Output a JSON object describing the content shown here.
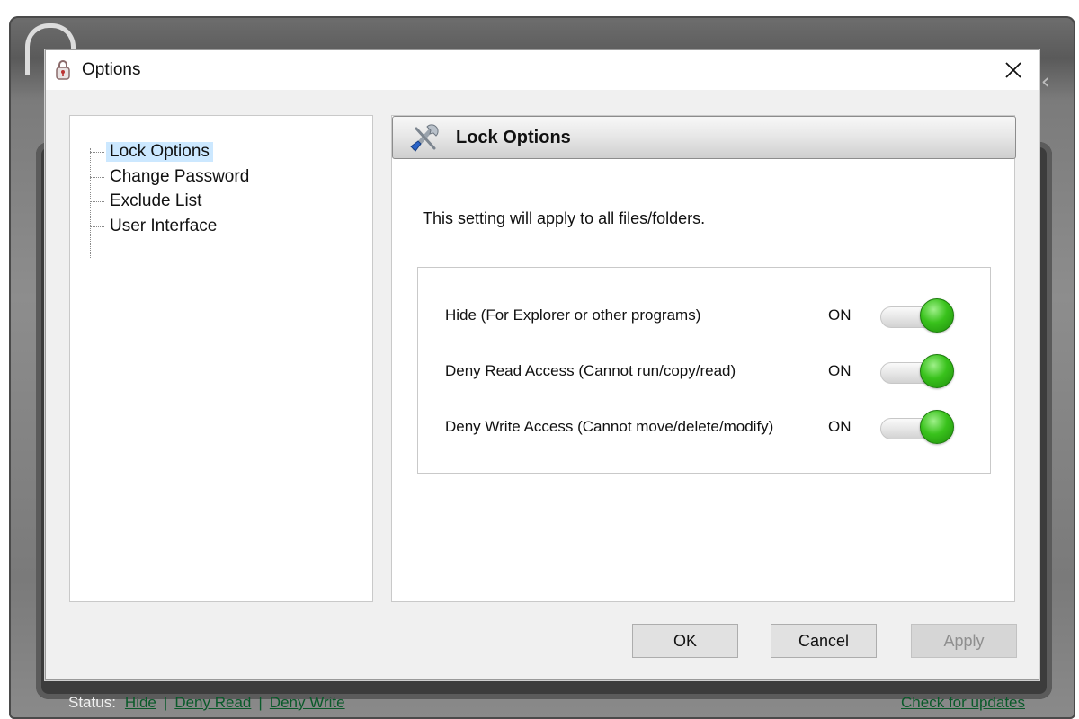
{
  "dialog": {
    "title": "Options",
    "close_label": "✕"
  },
  "tree": {
    "items": [
      {
        "label": "Lock Options",
        "selected": true
      },
      {
        "label": "Change Password",
        "selected": false
      },
      {
        "label": "Exclude List",
        "selected": false
      },
      {
        "label": "User Interface",
        "selected": false
      }
    ]
  },
  "panel": {
    "header_title": "Lock Options",
    "header_icon": "tools-icon",
    "intro": "This setting will apply to all files/folders.",
    "options": [
      {
        "label": "Hide (For Explorer or other programs)",
        "state": "ON",
        "on": true
      },
      {
        "label": "Deny Read Access (Cannot run/copy/read)",
        "state": "ON",
        "on": true
      },
      {
        "label": "Deny Write Access (Cannot move/delete/modify)",
        "state": "ON",
        "on": true
      }
    ]
  },
  "buttons": {
    "ok": "OK",
    "cancel": "Cancel",
    "apply": "Apply"
  },
  "status_bar": {
    "label": "Status:",
    "hide": "Hide",
    "deny_read": "Deny Read",
    "deny_write": "Deny Write",
    "separator": "|",
    "check_updates": "Check for updates"
  },
  "colors": {
    "selection": "#cce8ff",
    "toggle_on": "#39c21c",
    "link": "#0a5a2a"
  }
}
